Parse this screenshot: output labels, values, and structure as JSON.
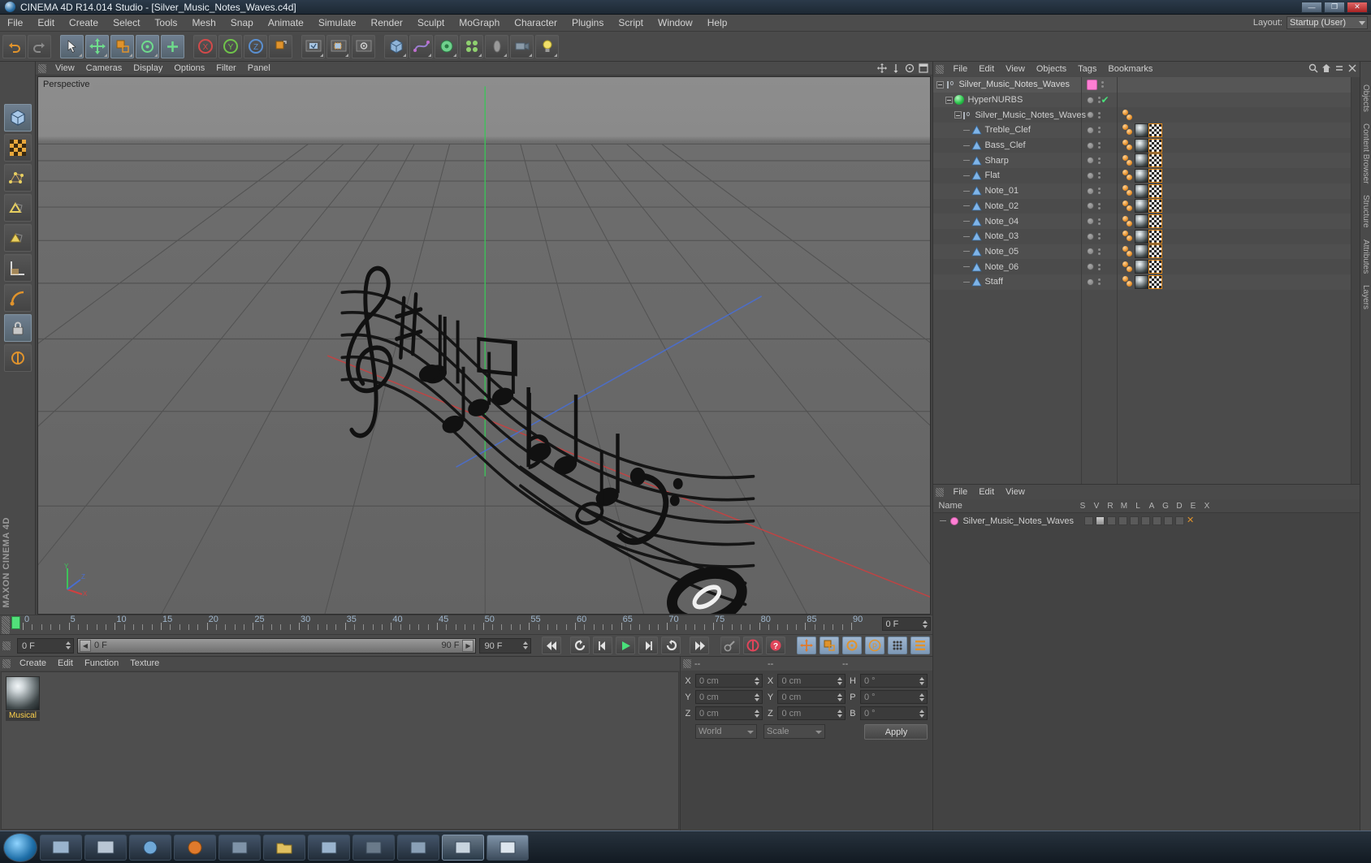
{
  "window": {
    "app_icon": "cinema4d-icon",
    "title": "CINEMA 4D R14.014 Studio - [Silver_Music_Notes_Waves.c4d]",
    "minimize": "—",
    "maximize": "❐",
    "close": "✕"
  },
  "menubar": {
    "items": [
      "File",
      "Edit",
      "Create",
      "Select",
      "Tools",
      "Mesh",
      "Snap",
      "Animate",
      "Simulate",
      "Render",
      "Sculpt",
      "MoGraph",
      "Character",
      "Plugins",
      "Script",
      "Window",
      "Help"
    ],
    "layout_label": "Layout:",
    "layout_value": "Startup (User)"
  },
  "toolbar": {
    "buttons": [
      {
        "name": "undo-button",
        "icon": "undo-arrow-icon"
      },
      {
        "name": "redo-button",
        "icon": "redo-arrow-icon"
      },
      {
        "name": "select-tool",
        "icon": "cursor-icon",
        "active": true
      },
      {
        "name": "move-tool",
        "icon": "move-axis-icon",
        "active": true
      },
      {
        "name": "scale-tool",
        "icon": "scale-box-icon",
        "active": true
      },
      {
        "name": "rotate-tool",
        "icon": "rotate-ring-icon",
        "active": true
      },
      {
        "name": "add-tool",
        "icon": "plus-cross-icon",
        "active": true
      },
      {
        "name": "lock-x-axis",
        "icon": "x-axis-icon"
      },
      {
        "name": "lock-y-axis",
        "icon": "y-axis-icon"
      },
      {
        "name": "lock-z-axis",
        "icon": "z-axis-icon"
      },
      {
        "name": "world-object-coords",
        "icon": "world-axis-icon"
      },
      {
        "name": "render-view",
        "icon": "render-view-icon"
      },
      {
        "name": "render-region",
        "icon": "render-region-icon"
      },
      {
        "name": "render-settings",
        "icon": "render-settings-icon"
      },
      {
        "name": "add-cube-object",
        "icon": "cube-icon"
      },
      {
        "name": "add-spline",
        "icon": "spline-icon"
      },
      {
        "name": "add-generator",
        "icon": "generator-icon"
      },
      {
        "name": "add-deformer",
        "icon": "deformer-icon"
      },
      {
        "name": "add-environment",
        "icon": "environment-icon"
      },
      {
        "name": "add-camera",
        "icon": "camera-icon"
      },
      {
        "name": "add-light",
        "icon": "light-bulb-icon"
      }
    ]
  },
  "left_tools": {
    "buttons": [
      {
        "name": "model-mode",
        "icon": "model-cube-icon",
        "active": true
      },
      {
        "name": "texture-mode",
        "icon": "texture-checker-icon"
      },
      {
        "name": "points-mode",
        "icon": "points-icon"
      },
      {
        "name": "edges-mode",
        "icon": "edges-icon"
      },
      {
        "name": "polygons-mode",
        "icon": "polygons-icon"
      },
      {
        "name": "workplane-mode",
        "icon": "workplane-icon"
      },
      {
        "name": "enable-axis-mode",
        "icon": "axis-bend-icon"
      },
      {
        "name": "lock-axis-mode",
        "icon": "padlock-icon",
        "active": true
      },
      {
        "name": "viewport-solo",
        "icon": "solo-circle-icon"
      }
    ],
    "brand": "MAXON CINEMA 4D"
  },
  "viewport": {
    "menu": [
      "View",
      "Cameras",
      "Display",
      "Options",
      "Filter",
      "Panel"
    ],
    "nav_icons": [
      "pan-icon",
      "zoom-icon",
      "rotate-icon",
      "maximize-view-icon"
    ],
    "label": "Perspective",
    "axis_gizmo": {
      "y": "Y",
      "x": "X",
      "z": "Z"
    },
    "scene": "3d-music-notes-wave-staff"
  },
  "timeline": {
    "ruler_labels": [
      "0",
      "5",
      "10",
      "15",
      "20",
      "25",
      "30",
      "35",
      "40",
      "45",
      "50",
      "55",
      "60",
      "65",
      "70",
      "75",
      "80",
      "85",
      "90"
    ],
    "current_frame_field": "0 F",
    "playhead_frame": "0",
    "frame_from": "0 F",
    "range_start": "0 F",
    "range_end": "90 F",
    "frame_to": "90 F",
    "transport": [
      {
        "name": "go-to-start-button",
        "icon": "skip-start-icon"
      },
      {
        "name": "play-backwards-button",
        "icon": "rewind-loop-icon"
      },
      {
        "name": "previous-frame-button",
        "icon": "step-back-icon"
      },
      {
        "name": "play-forward-button",
        "icon": "play-icon"
      },
      {
        "name": "next-frame-button",
        "icon": "step-forward-icon"
      },
      {
        "name": "play-loop-button",
        "icon": "loop-icon"
      },
      {
        "name": "go-to-end-button",
        "icon": "skip-end-icon"
      }
    ],
    "key_buttons": [
      {
        "name": "autokey-button",
        "icon": "key-icon"
      },
      {
        "name": "record-active-objects-button",
        "icon": "record-icon"
      },
      {
        "name": "keyframe-selection-button",
        "icon": "question-icon"
      }
    ],
    "key_toggles": [
      {
        "name": "position-key-toggle",
        "icon": "position-cross-icon"
      },
      {
        "name": "scale-key-toggle",
        "icon": "scale-icon"
      },
      {
        "name": "rotation-key-toggle",
        "icon": "rotation-icon"
      },
      {
        "name": "param-key-toggle",
        "icon": "p-letter-icon"
      },
      {
        "name": "pla-key-toggle",
        "icon": "pla-dots-icon"
      },
      {
        "name": "timeline-layout-toggle",
        "icon": "timeline-bars-icon"
      }
    ]
  },
  "material_manager": {
    "menu": [
      "Create",
      "Edit",
      "Function",
      "Texture"
    ],
    "materials": [
      {
        "name": "Musical",
        "preview": "chrome-sphere-preview",
        "selected": true
      }
    ]
  },
  "coordinates": {
    "headers": [
      "--",
      "--",
      "--"
    ],
    "rows": [
      {
        "pos_label": "X",
        "pos_value": "0 cm",
        "size_label": "X",
        "size_value": "0 cm",
        "rot_label": "H",
        "rot_value": "0 °"
      },
      {
        "pos_label": "Y",
        "pos_value": "0 cm",
        "size_label": "Y",
        "size_value": "0 cm",
        "rot_label": "P",
        "rot_value": "0 °"
      },
      {
        "pos_label": "Z",
        "pos_value": "0 cm",
        "size_label": "Z",
        "size_value": "0 cm",
        "rot_label": "B",
        "rot_value": "0 °"
      }
    ],
    "coord_system": "World",
    "mode": "Scale",
    "apply_label": "Apply"
  },
  "object_manager": {
    "menu": [
      "File",
      "Edit",
      "View",
      "Objects",
      "Tags",
      "Bookmarks"
    ],
    "tool_icons": [
      "search-icon",
      "home-icon",
      "collapse-icon",
      "close-icon"
    ],
    "objects": [
      {
        "label": "Silver_Music_Notes_Waves",
        "icon": "null-object-icon",
        "depth": 0,
        "expander": "minus",
        "dot_color": "#ff7fd4",
        "tags": []
      },
      {
        "label": "HyperNURBS",
        "icon": "hypernurbs-icon",
        "depth": 1,
        "expander": "minus",
        "check": true,
        "tags": []
      },
      {
        "label": "Silver_Music_Notes_Waves",
        "icon": "null-object-icon",
        "depth": 2,
        "expander": "minus",
        "tags": [
          "phong"
        ]
      },
      {
        "label": "Treble_Clef",
        "icon": "polygon-object-icon",
        "depth": 3,
        "tags": [
          "phong",
          "material",
          "texture"
        ]
      },
      {
        "label": "Bass_Clef",
        "icon": "polygon-object-icon",
        "depth": 3,
        "tags": [
          "phong",
          "material",
          "texture"
        ]
      },
      {
        "label": "Sharp",
        "icon": "polygon-object-icon",
        "depth": 3,
        "tags": [
          "phong",
          "material",
          "texture"
        ]
      },
      {
        "label": "Flat",
        "icon": "polygon-object-icon",
        "depth": 3,
        "tags": [
          "phong",
          "material",
          "texture"
        ]
      },
      {
        "label": "Note_01",
        "icon": "polygon-object-icon",
        "depth": 3,
        "tags": [
          "phong",
          "material",
          "texture"
        ]
      },
      {
        "label": "Note_02",
        "icon": "polygon-object-icon",
        "depth": 3,
        "tags": [
          "phong",
          "material",
          "texture"
        ]
      },
      {
        "label": "Note_04",
        "icon": "polygon-object-icon",
        "depth": 3,
        "tags": [
          "phong",
          "material",
          "texture"
        ]
      },
      {
        "label": "Note_03",
        "icon": "polygon-object-icon",
        "depth": 3,
        "tags": [
          "phong",
          "material",
          "texture"
        ]
      },
      {
        "label": "Note_05",
        "icon": "polygon-object-icon",
        "depth": 3,
        "tags": [
          "phong",
          "material",
          "texture"
        ]
      },
      {
        "label": "Note_06",
        "icon": "polygon-object-icon",
        "depth": 3,
        "tags": [
          "phong",
          "material",
          "texture"
        ]
      },
      {
        "label": "Staff",
        "icon": "polygon-object-icon",
        "depth": 3,
        "tags": [
          "phong",
          "material",
          "texture"
        ]
      }
    ]
  },
  "layer_manager": {
    "menu": [
      "File",
      "Edit",
      "View"
    ],
    "columns": [
      "Name",
      "S",
      "V",
      "R",
      "M",
      "L",
      "A",
      "G",
      "D",
      "E",
      "X"
    ],
    "rows": [
      {
        "label": "Silver_Music_Notes_Waves",
        "color": "#ff7fd4"
      }
    ]
  },
  "dock_tabs": [
    "Objects",
    "Content Browser",
    "Structure",
    "Attributes",
    "Layers"
  ],
  "taskbar": {
    "items": [
      {
        "name": "start-button",
        "icon": "windows-orb-icon"
      },
      {
        "name": "taskbar-item-1",
        "icon": "app-icon"
      },
      {
        "name": "taskbar-item-2",
        "icon": "app-icon"
      },
      {
        "name": "taskbar-item-3",
        "icon": "app-icon"
      },
      {
        "name": "taskbar-item-4",
        "icon": "firefox-icon"
      },
      {
        "name": "taskbar-item-5",
        "icon": "app-icon"
      },
      {
        "name": "taskbar-item-6",
        "icon": "folder-icon"
      },
      {
        "name": "taskbar-item-7",
        "icon": "app-icon"
      },
      {
        "name": "taskbar-item-8",
        "icon": "app-icon"
      },
      {
        "name": "taskbar-item-9",
        "icon": "app-icon"
      },
      {
        "name": "taskbar-item-10",
        "icon": "c4d-icon"
      },
      {
        "name": "taskbar-item-11",
        "icon": "app-icon"
      }
    ]
  }
}
